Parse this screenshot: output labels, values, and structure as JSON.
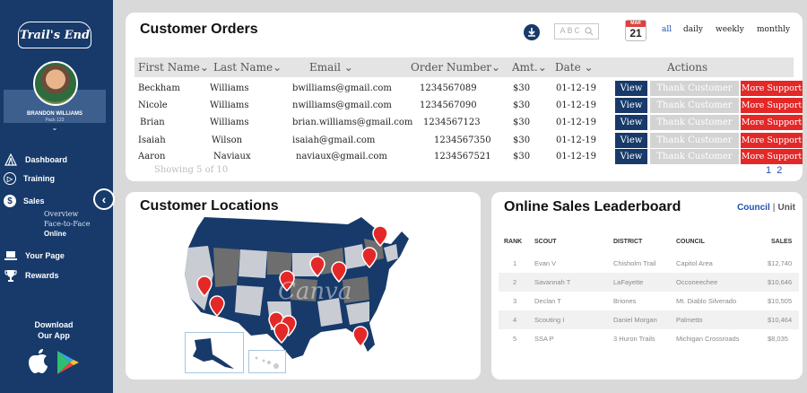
{
  "sidebar": {
    "logo": "Trail's End",
    "user": {
      "name": "BRANDON WILLIAMS",
      "pack": "Pack 123"
    },
    "nav": [
      {
        "label": "Dashboard",
        "icon": "tent-icon"
      },
      {
        "label": "Training",
        "icon": "play-circle-icon"
      },
      {
        "label": "Sales",
        "icon": "dollar-icon"
      },
      {
        "label": "Your Page",
        "icon": "laptop-icon"
      },
      {
        "label": "Rewards",
        "icon": "trophy-icon"
      }
    ],
    "sales_sub": [
      "Overview",
      "Face-to-Face",
      "Online"
    ],
    "download": [
      "Download",
      "Our App"
    ]
  },
  "orders": {
    "title": "Customer Orders",
    "search_placeholder": "ABC",
    "calendar": {
      "month": "MAR",
      "day": "21"
    },
    "ranges": [
      "all",
      "daily",
      "weekly",
      "monthly"
    ],
    "columns": [
      "First Name",
      "Last Name",
      "Email",
      "Order Number",
      "Amt.",
      "Date",
      "Actions"
    ],
    "rows": [
      {
        "first": "Beckham",
        "last": "Williams",
        "email": "bwilliams@gmail.com",
        "order": "1234567089",
        "amt": "$30",
        "date": "01-12-19"
      },
      {
        "first": "Nicole",
        "last": "Williams",
        "email": "nwilliams@gmail.com",
        "order": "1234567090",
        "amt": "$30",
        "date": "01-12-19"
      },
      {
        "first": "Brian",
        "last": "Williams",
        "email": "brian.williams@gmail.com",
        "order": "1234567123",
        "amt": "$30",
        "date": "01-12-19"
      },
      {
        "first": "Isaiah",
        "last": "Wilson",
        "email": "isaiah@gmail.com",
        "order": "1234567350",
        "amt": "$30",
        "date": "01-12-19"
      },
      {
        "first": "Aaron",
        "last": "Naviaux",
        "email": "naviaux@gmail.com",
        "order": "1234567521",
        "amt": "$30",
        "date": "01-12-19"
      }
    ],
    "actions": {
      "view": "View",
      "thank": "Thank Customer",
      "more": "More Support"
    },
    "showing": "Showing 5 of 10",
    "pages": [
      "1",
      "2"
    ]
  },
  "locations": {
    "title": "Customer Locations",
    "watermark": "Canva"
  },
  "leaderboard": {
    "title": "Online Sales Leaderboard",
    "tabs": {
      "council": "Council",
      "sep": "|",
      "unit": "Unit"
    },
    "columns": [
      "RANK",
      "SCOUT",
      "DISTRICT",
      "COUNCIL",
      "SALES"
    ],
    "rows": [
      {
        "rank": "1",
        "scout": "Evan V",
        "district": "Chisholm Trail",
        "council": "Capitol Area",
        "sales": "$12,740"
      },
      {
        "rank": "2",
        "scout": "Savannah T",
        "district": "LaFayette",
        "council": "Occoneechee",
        "sales": "$10,646"
      },
      {
        "rank": "3",
        "scout": "Declan T",
        "district": "Briones",
        "council": "Mt. Diablo Silverado",
        "sales": "$10,505"
      },
      {
        "rank": "4",
        "scout": "Scouting I",
        "district": "Daniel Morgan",
        "council": "Palmetto",
        "sales": "$10,464"
      },
      {
        "rank": "5",
        "scout": "SSA P",
        "district": "3 Huron Trails",
        "council": "Michigan Crossroads",
        "sales": "$8,035"
      }
    ]
  },
  "colors": {
    "navy": "#173a6a",
    "red": "#e42828",
    "accent_blue": "#1e4fb4",
    "grey": "#d3d3d3"
  }
}
